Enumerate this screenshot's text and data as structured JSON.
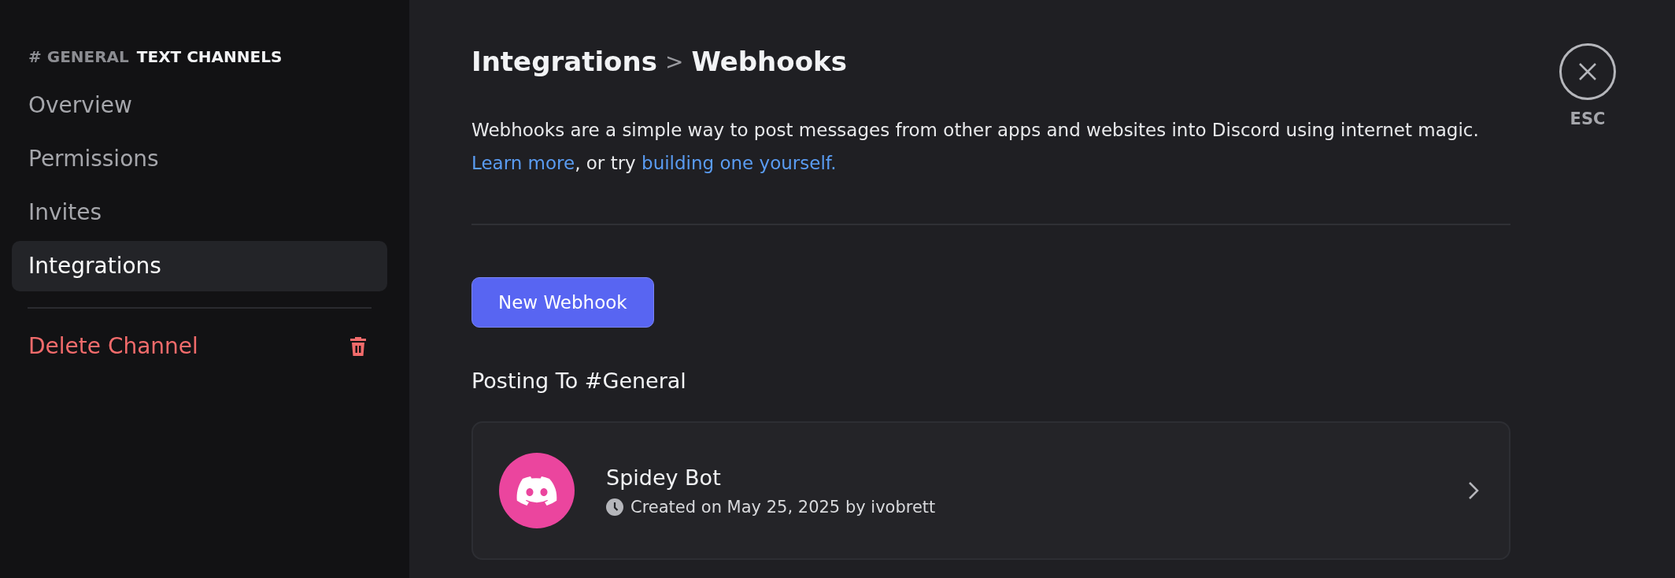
{
  "sidebar": {
    "header": {
      "channel": "# GENERAL",
      "category": "TEXT CHANNELS"
    },
    "items": [
      {
        "label": "Overview",
        "selected": false
      },
      {
        "label": "Permissions",
        "selected": false
      },
      {
        "label": "Invites",
        "selected": false
      },
      {
        "label": "Integrations",
        "selected": true
      }
    ],
    "delete_item": {
      "label": "Delete Channel"
    }
  },
  "breadcrumb": {
    "parent": "Integrations",
    "separator": ">",
    "current": "Webhooks"
  },
  "description": {
    "text": "Webhooks are a simple way to post messages from other apps and websites into Discord using internet magic.",
    "link_1": "Learn more",
    "middle": ", or try",
    "link_2": "building one yourself."
  },
  "new_button": "New Webhook",
  "section_title": "Posting To #General",
  "webhooks": [
    {
      "name": "Spidey Bot",
      "meta": "Created on May 25, 2025 by ivobrett",
      "color": "#eb459e"
    }
  ],
  "close": {
    "label": "ESC"
  }
}
